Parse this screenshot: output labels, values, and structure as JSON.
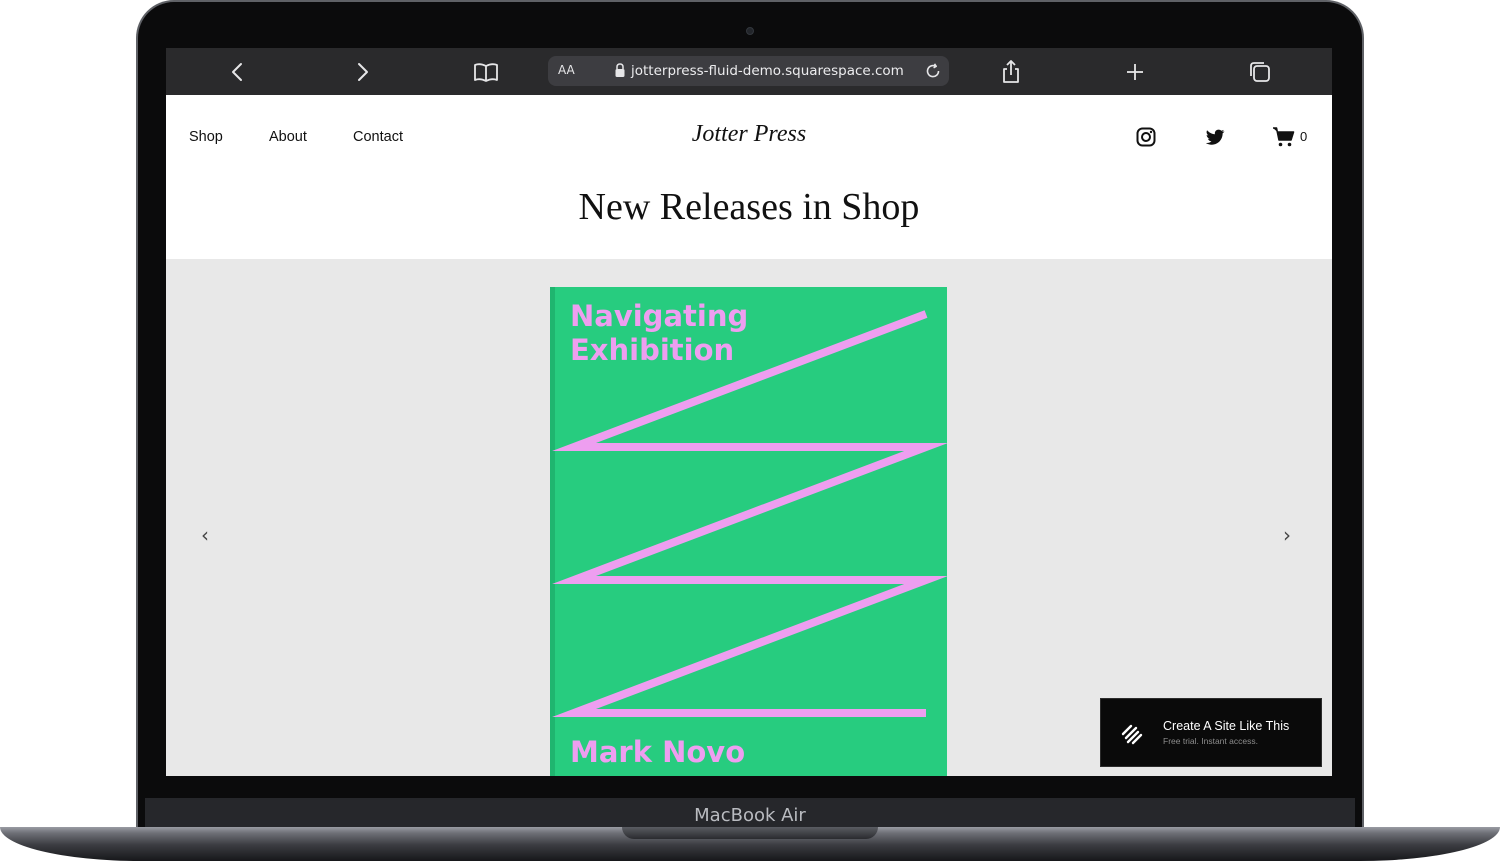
{
  "device": {
    "label": "MacBook Air"
  },
  "browser": {
    "text_size_label": "AA",
    "url": "jotterpress-fluid-demo.squarespace.com"
  },
  "site": {
    "nav": [
      "Shop",
      "About",
      "Contact"
    ],
    "brand": "Jotter Press",
    "cart_count": "0",
    "page_title": "New Releases in Shop"
  },
  "carousel": {
    "prev_glyph": "‹",
    "next_glyph": "›",
    "book": {
      "title_line1": "Navigating",
      "title_line2": "Exhibition",
      "author": "Mark Novo",
      "cover_color": "#27cc7f",
      "accent_color": "#ee9ef0"
    }
  },
  "badge": {
    "title": "Create A Site Like This",
    "subtitle": "Free trial. Instant access."
  }
}
